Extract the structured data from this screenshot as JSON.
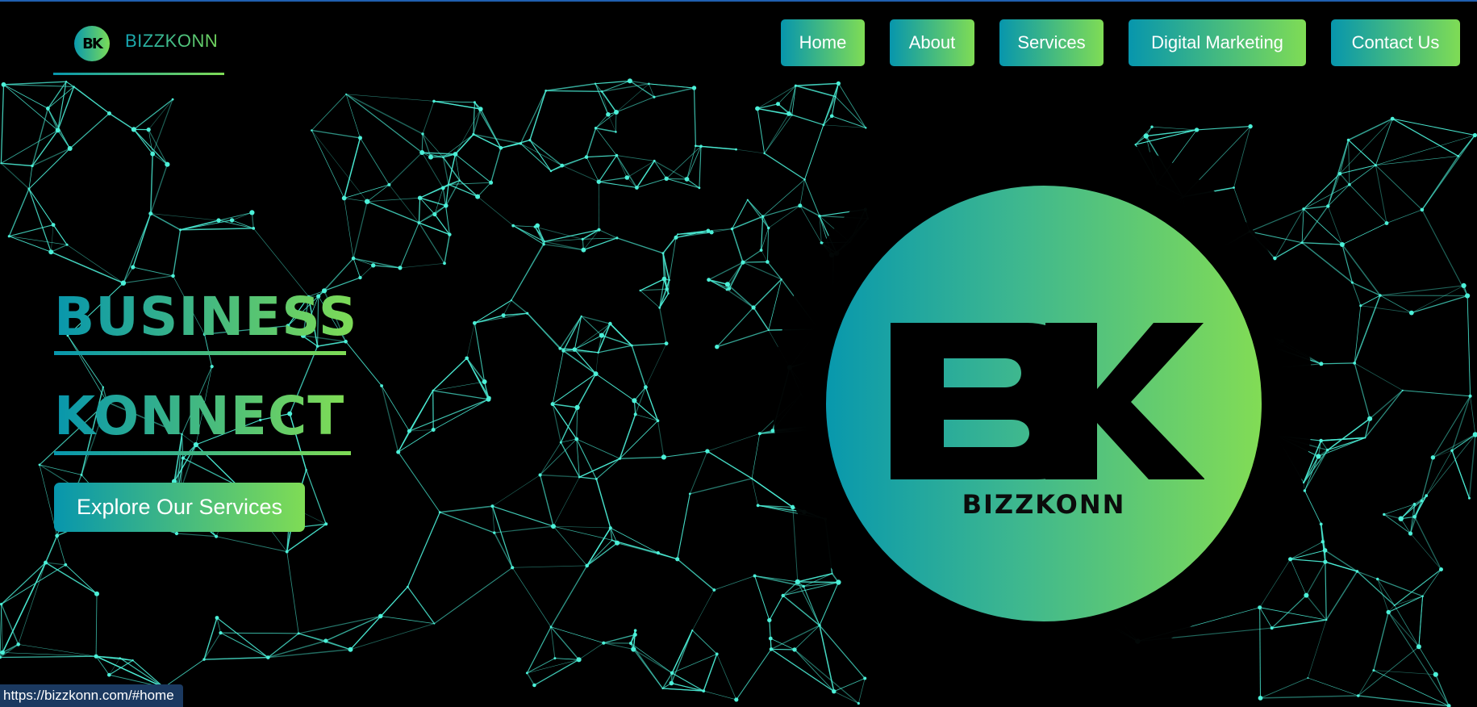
{
  "brand": {
    "logo_text": "BK",
    "name": "BIZZKONN"
  },
  "nav": {
    "home": "Home",
    "about": "About",
    "services": "Services",
    "digital_marketing": "Digital Marketing",
    "contact": "Contact Us"
  },
  "hero": {
    "line1": "BUSINESS",
    "line2": "KONNECT",
    "cta": "Explore Our Services"
  },
  "logo": {
    "monogram": "BK",
    "wordmark": "BIZZKONN"
  },
  "status_bar": {
    "url": "https://bizzkonn.com/#home"
  },
  "colors": {
    "gradient_start": "#0796ad",
    "gradient_end": "#7fdc55",
    "network_line": "#4cf0d8",
    "background": "#000000"
  }
}
